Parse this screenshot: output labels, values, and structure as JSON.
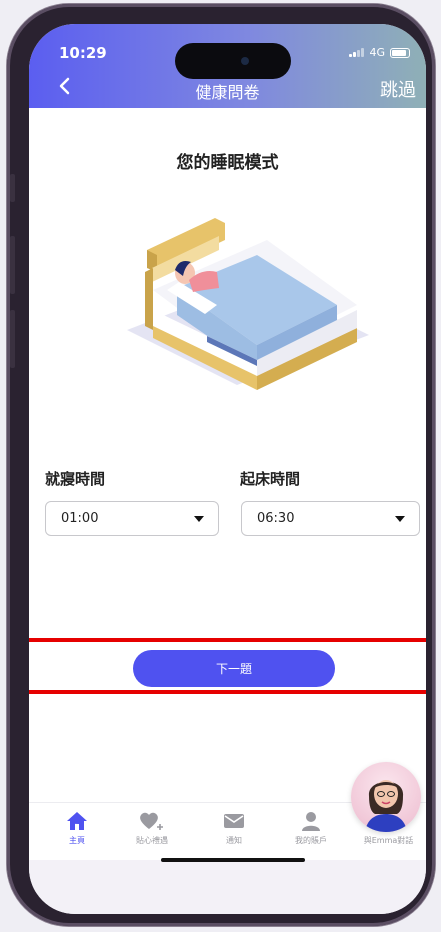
{
  "status": {
    "time": "10:29",
    "network": "4G"
  },
  "header": {
    "title": "健康問卷",
    "skip_label": "跳過"
  },
  "question": {
    "title": "您的睡眠模式"
  },
  "bedtime": {
    "label": "就寢時間",
    "value": "01:00"
  },
  "waketime": {
    "label": "起床時間",
    "value": "06:30"
  },
  "next_button": {
    "label": "下一題"
  },
  "tabs": [
    {
      "label": "主頁",
      "icon": "home-icon",
      "active": true
    },
    {
      "label": "貼心禮遇",
      "icon": "heart-plus-icon",
      "active": false
    },
    {
      "label": "通知",
      "icon": "mail-icon",
      "active": false
    },
    {
      "label": "我的賬戶",
      "icon": "user-icon",
      "active": false
    },
    {
      "label": "與Emma對話",
      "icon": "emma-avatar",
      "active": false
    }
  ],
  "colors": {
    "accent": "#4f52f0",
    "highlight": "#e60000"
  }
}
